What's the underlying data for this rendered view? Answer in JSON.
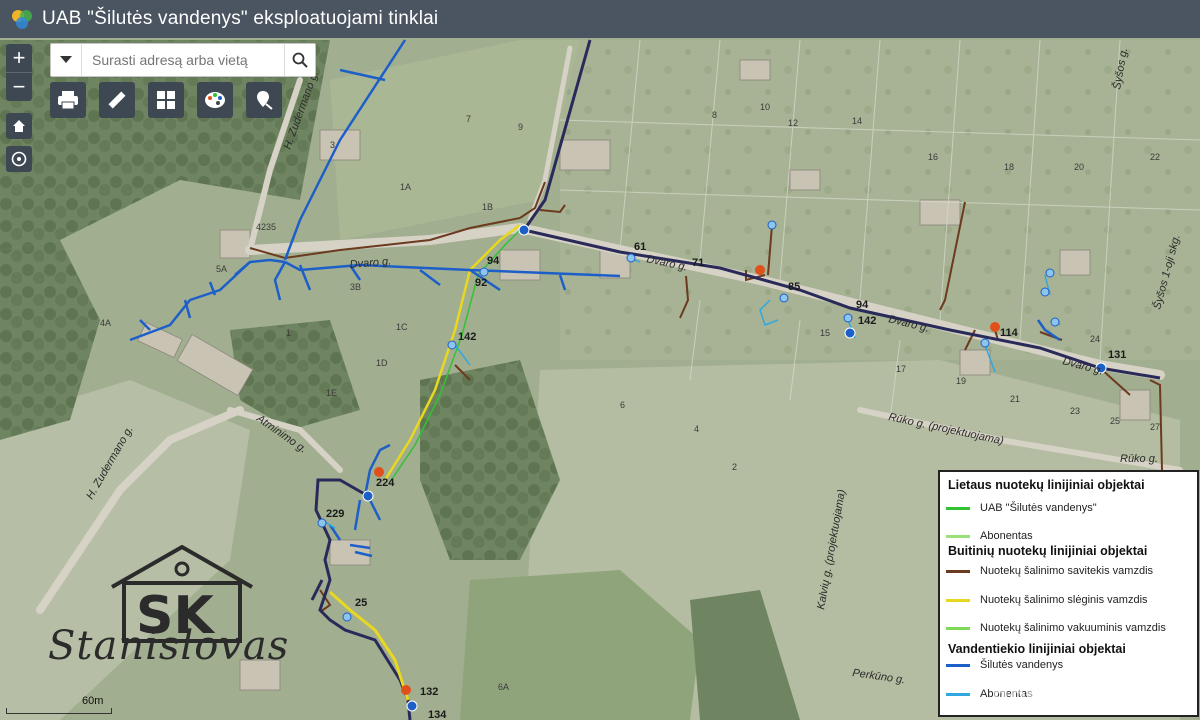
{
  "app": {
    "title": "UAB \"Šilutės vandenys\" eksploatuojami tinklai",
    "logo_icon": "arcgis-app-logo-icon"
  },
  "controls": {
    "zoom_in": "+",
    "zoom_out": "−",
    "home_icon": "home-icon",
    "locate_icon": "locate-icon"
  },
  "search": {
    "placeholder": "Surasti adresą arba vietą",
    "value": ""
  },
  "toolbar": {
    "icons": [
      "print-icon",
      "measure-icon",
      "basemap-gallery-icon",
      "layers-palette-icon",
      "draw-marker-icon"
    ]
  },
  "map": {
    "street_labels": [
      "Dvaro g.",
      "Dvaro g.",
      "Dvaro g.",
      "Dvaro g.",
      "H. Zudermano g.",
      "H. Zudermano g.",
      "Atminimo g.",
      "Rūko g. (projektuojama)",
      "Perkūno g.",
      "Kalvių g. (projektuojama)",
      "Šyšos 1-oji skg.",
      "Šyšos g.",
      "Rūko g."
    ],
    "node_labels": [
      "94",
      "92",
      "142",
      "61",
      "71",
      "85",
      "94",
      "142",
      "114",
      "131",
      "224",
      "229",
      "25",
      "132",
      "134",
      "4235"
    ],
    "parcel_labels": [
      "7",
      "9",
      "3",
      "1A",
      "1B",
      "5A",
      "3B",
      "1",
      "1E",
      "1D",
      "1C",
      "6",
      "4",
      "2",
      "6A",
      "4A",
      "8",
      "10",
      "12",
      "14",
      "16",
      "18",
      "20",
      "22",
      "15",
      "17",
      "19",
      "21",
      "23",
      "25",
      "27",
      "24"
    ]
  },
  "legend": {
    "rain_header": "Lietaus nuotekų linijiniai objektai",
    "rain_items": [
      {
        "label": "UAB \"Šilutės vandenys\"",
        "color": "#33c233"
      },
      {
        "label": "Abonentas",
        "color": "#9be07a"
      }
    ],
    "sewer_header": "Buitinių nuotekų linijiniai objektai",
    "sewer_items": [
      {
        "label": "Nuotekų šalinimo savitekis vamzdis",
        "color": "#6b3a1f"
      },
      {
        "label": "Nuotekų šalinimo slėginis vamzdis",
        "color": "#e8d820"
      },
      {
        "label": "Nuotekų šalinimo vakuuminis vamzdis",
        "color": "#7ed957"
      }
    ],
    "water_header": "Vandentiekio linijiniai objektai",
    "water_items": [
      {
        "label": "Šilutės vandenys",
        "color": "#1d5fc8"
      },
      {
        "label": "Abonentas",
        "color": "#2fa8e0"
      }
    ]
  },
  "scale": {
    "label": "60m"
  },
  "brand": {
    "name": "Stanislovas",
    "monogram": "SK"
  },
  "watermark": {
    "text": "domoplius.lt"
  },
  "colors": {
    "topbar": "#4a5561",
    "water_main": "#1d5fc8",
    "water_subscriber": "#2fa8e0",
    "sewer_gravity": "#6b3a1f",
    "sewer_pressure": "#e8d820",
    "sewer_main_dark": "#2a2a5a",
    "marker_hydrant": "#e0501a"
  }
}
